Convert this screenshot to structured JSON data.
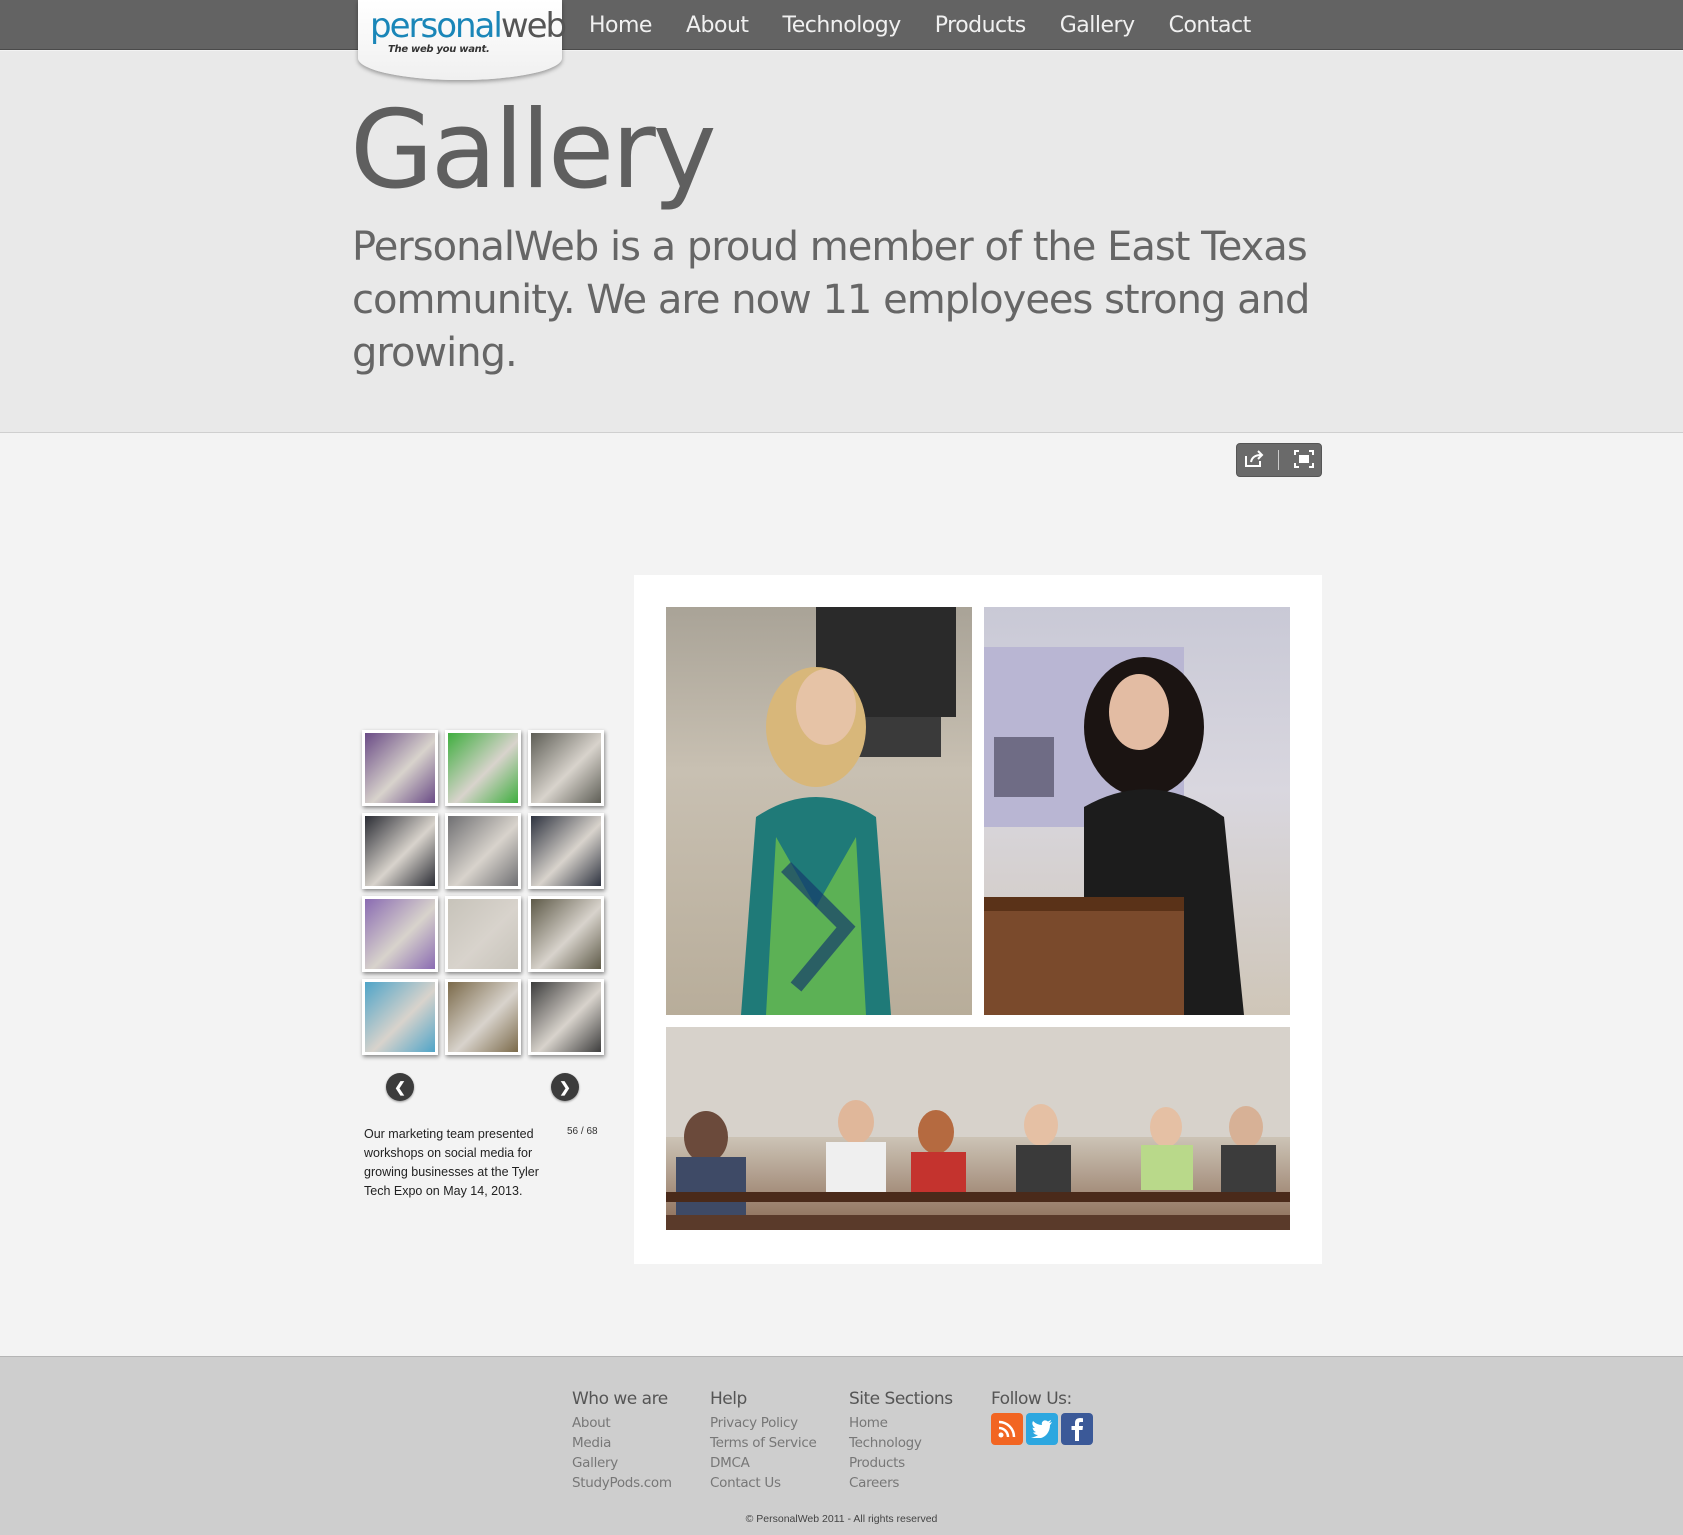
{
  "brand": {
    "logo_main": "personal",
    "logo_web": "web",
    "logo_tagline": "The web you want."
  },
  "nav": {
    "items": [
      "Home",
      "About",
      "Technology",
      "Products",
      "Gallery",
      "Contact"
    ]
  },
  "hero": {
    "title": "Gallery",
    "text": "PersonalWeb is a proud member of the East Texas community. We are now 11 employees strong and growing."
  },
  "gallery": {
    "tools": {
      "share_icon": "share-icon",
      "fullscreen_icon": "fullscreen-icon"
    },
    "caption": "Our marketing team presented workshops on social media for growing businesses at the Tyler Tech Expo on May 14, 2013.",
    "counter": "56 / 68",
    "prev_icon": "chevron-left-icon",
    "next_icon": "chevron-right-icon",
    "thumb_colors": [
      "#6a4b86",
      "#3fae3f",
      "#5e5e56",
      "#2b2d35",
      "#6f6f72",
      "#2e3340",
      "#8a6bb2",
      "#c7c3ba",
      "#5e5a48",
      "#4fa4c8",
      "#7b6a4a",
      "#3d3d3d"
    ]
  },
  "footer": {
    "columns": [
      {
        "title": "Who we are",
        "links": [
          "About",
          "Media",
          "Gallery",
          "StudyPods.com"
        ]
      },
      {
        "title": "Help",
        "links": [
          "Privacy Policy",
          "Terms of Service",
          "DMCA",
          "Contact Us"
        ]
      },
      {
        "title": "Site Sections",
        "links": [
          "Home",
          "Technology",
          "Products",
          "Careers"
        ]
      }
    ],
    "follow_title": "Follow Us:",
    "social": [
      {
        "name": "rss-icon",
        "color": "#f26522"
      },
      {
        "name": "twitter-icon",
        "color": "#2ca7e0"
      },
      {
        "name": "facebook-icon",
        "color": "#3b5998"
      }
    ],
    "copyright": "© PersonalWeb 2011 - All rights reserved"
  }
}
